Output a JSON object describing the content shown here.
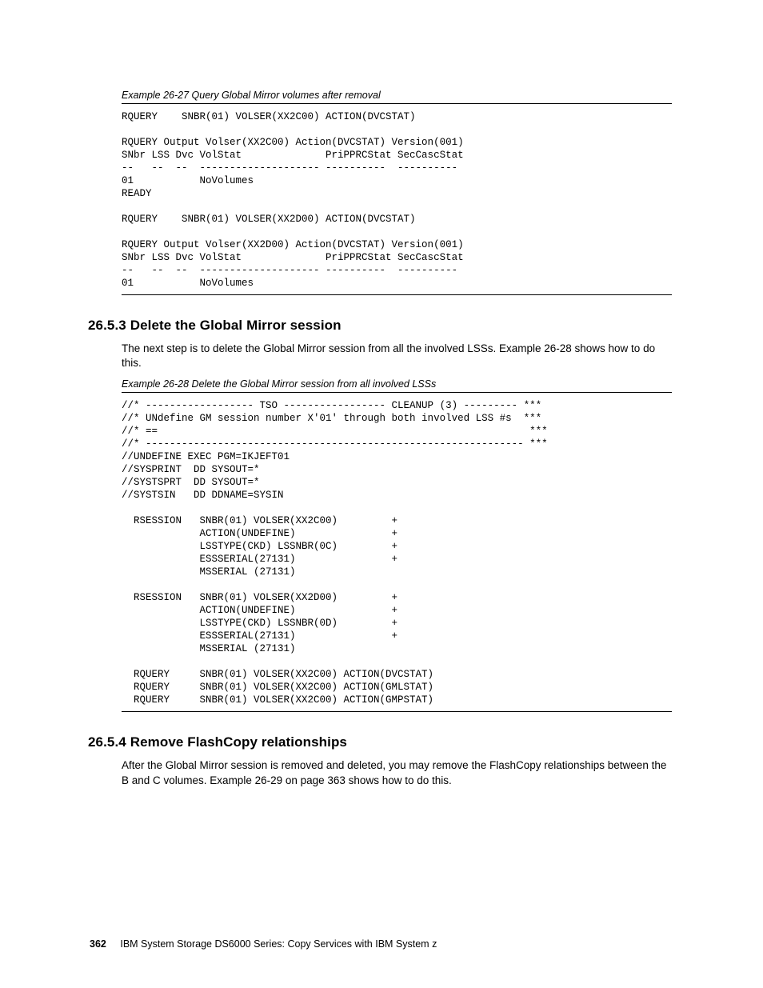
{
  "example27": {
    "caption": "Example 26-27   Query Global Mirror volumes after removal",
    "code": "RQUERY    SNBR(01) VOLSER(XX2C00) ACTION(DVCSTAT)\n\nRQUERY Output Volser(XX2C00) Action(DVCSTAT) Version(001)\nSNbr LSS Dvc VolStat              PriPPRCStat SecCascStat\n--   --  --  -------------------- ----------  ----------\n01           NoVolumes\nREADY\n\nRQUERY    SNBR(01) VOLSER(XX2D00) ACTION(DVCSTAT)\n\nRQUERY Output Volser(XX2D00) Action(DVCSTAT) Version(001)\nSNbr LSS Dvc VolStat              PriPPRCStat SecCascStat\n--   --  --  -------------------- ----------  ----------\n01           NoVolumes"
  },
  "section2653": {
    "heading": "26.5.3  Delete the Global Mirror session",
    "p1": "The next step is to delete the Global Mirror session from all the involved LSSs. Example 26-28 shows how to do this."
  },
  "example28": {
    "caption": "Example 26-28   Delete the Global Mirror session from all involved LSSs",
    "code": "//* ------------------ TSO ----------------- CLEANUP (3) --------- ***\n//* UNdefine GM session number X'01' through both involved LSS #s  ***\n//* ==                                                              ***\n//* --------------------------------------------------------------- ***\n//UNDEFINE EXEC PGM=IKJEFT01\n//SYSPRINT  DD SYSOUT=*\n//SYSTSPRT  DD SYSOUT=*\n//SYSTSIN   DD DDNAME=SYSIN\n\n  RSESSION   SNBR(01) VOLSER(XX2C00)         +\n             ACTION(UNDEFINE)                +\n             LSSTYPE(CKD) LSSNBR(0C)         +\n             ESSSERIAL(27131)                +\n             MSSERIAL (27131)\n\n  RSESSION   SNBR(01) VOLSER(XX2D00)         +\n             ACTION(UNDEFINE)                +\n             LSSTYPE(CKD) LSSNBR(0D)         +\n             ESSSERIAL(27131)                +\n             MSSERIAL (27131)\n\n  RQUERY     SNBR(01) VOLSER(XX2C00) ACTION(DVCSTAT)\n  RQUERY     SNBR(01) VOLSER(XX2C00) ACTION(GMLSTAT)\n  RQUERY     SNBR(01) VOLSER(XX2C00) ACTION(GMPSTAT)"
  },
  "section2654": {
    "heading": "26.5.4  Remove FlashCopy relationships",
    "p1": "After the Global Mirror session is removed and deleted, you may remove the FlashCopy relationships between the B and C volumes. Example 26-29 on page 363 shows how to do this."
  },
  "footer": {
    "pageNumber": "362",
    "bookTitle": "IBM System Storage DS6000 Series: Copy Services with IBM System z"
  }
}
